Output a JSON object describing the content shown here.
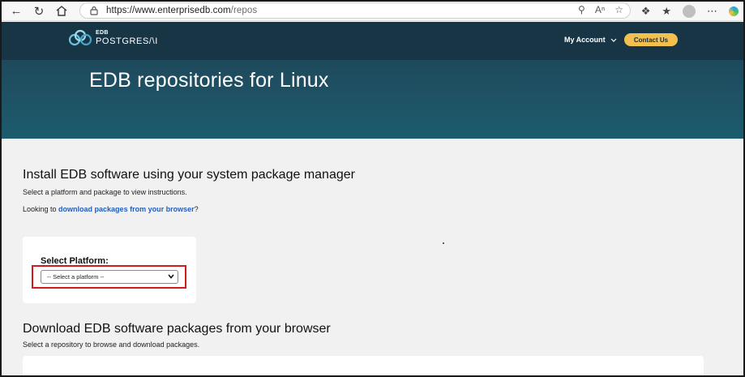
{
  "browser": {
    "url_host": "https://www.enterprisedb.com",
    "url_path": "/repos"
  },
  "header": {
    "logo_edb": "EDB",
    "logo_product": "POSTGRES/\\I",
    "my_account": "My Account",
    "contact_us": "Contact Us"
  },
  "hero": {
    "title": "EDB repositories for Linux"
  },
  "install_section": {
    "heading": "Install EDB software using your system package manager",
    "instructions": "Select a platform and package to view instructions.",
    "looking_prefix": "Looking to ",
    "looking_link": "download packages from your browser",
    "looking_suffix": "?",
    "select_label": "Select Platform:",
    "select_placeholder": "-- Select a platform --"
  },
  "download_section": {
    "heading": "Download EDB software packages from your browser",
    "instructions": "Select a repository to browse and download packages."
  },
  "colors": {
    "header_dark": "#183546",
    "accent_button": "#f1c04f",
    "link": "#1f5fbf",
    "highlight": "#d11a1a"
  }
}
